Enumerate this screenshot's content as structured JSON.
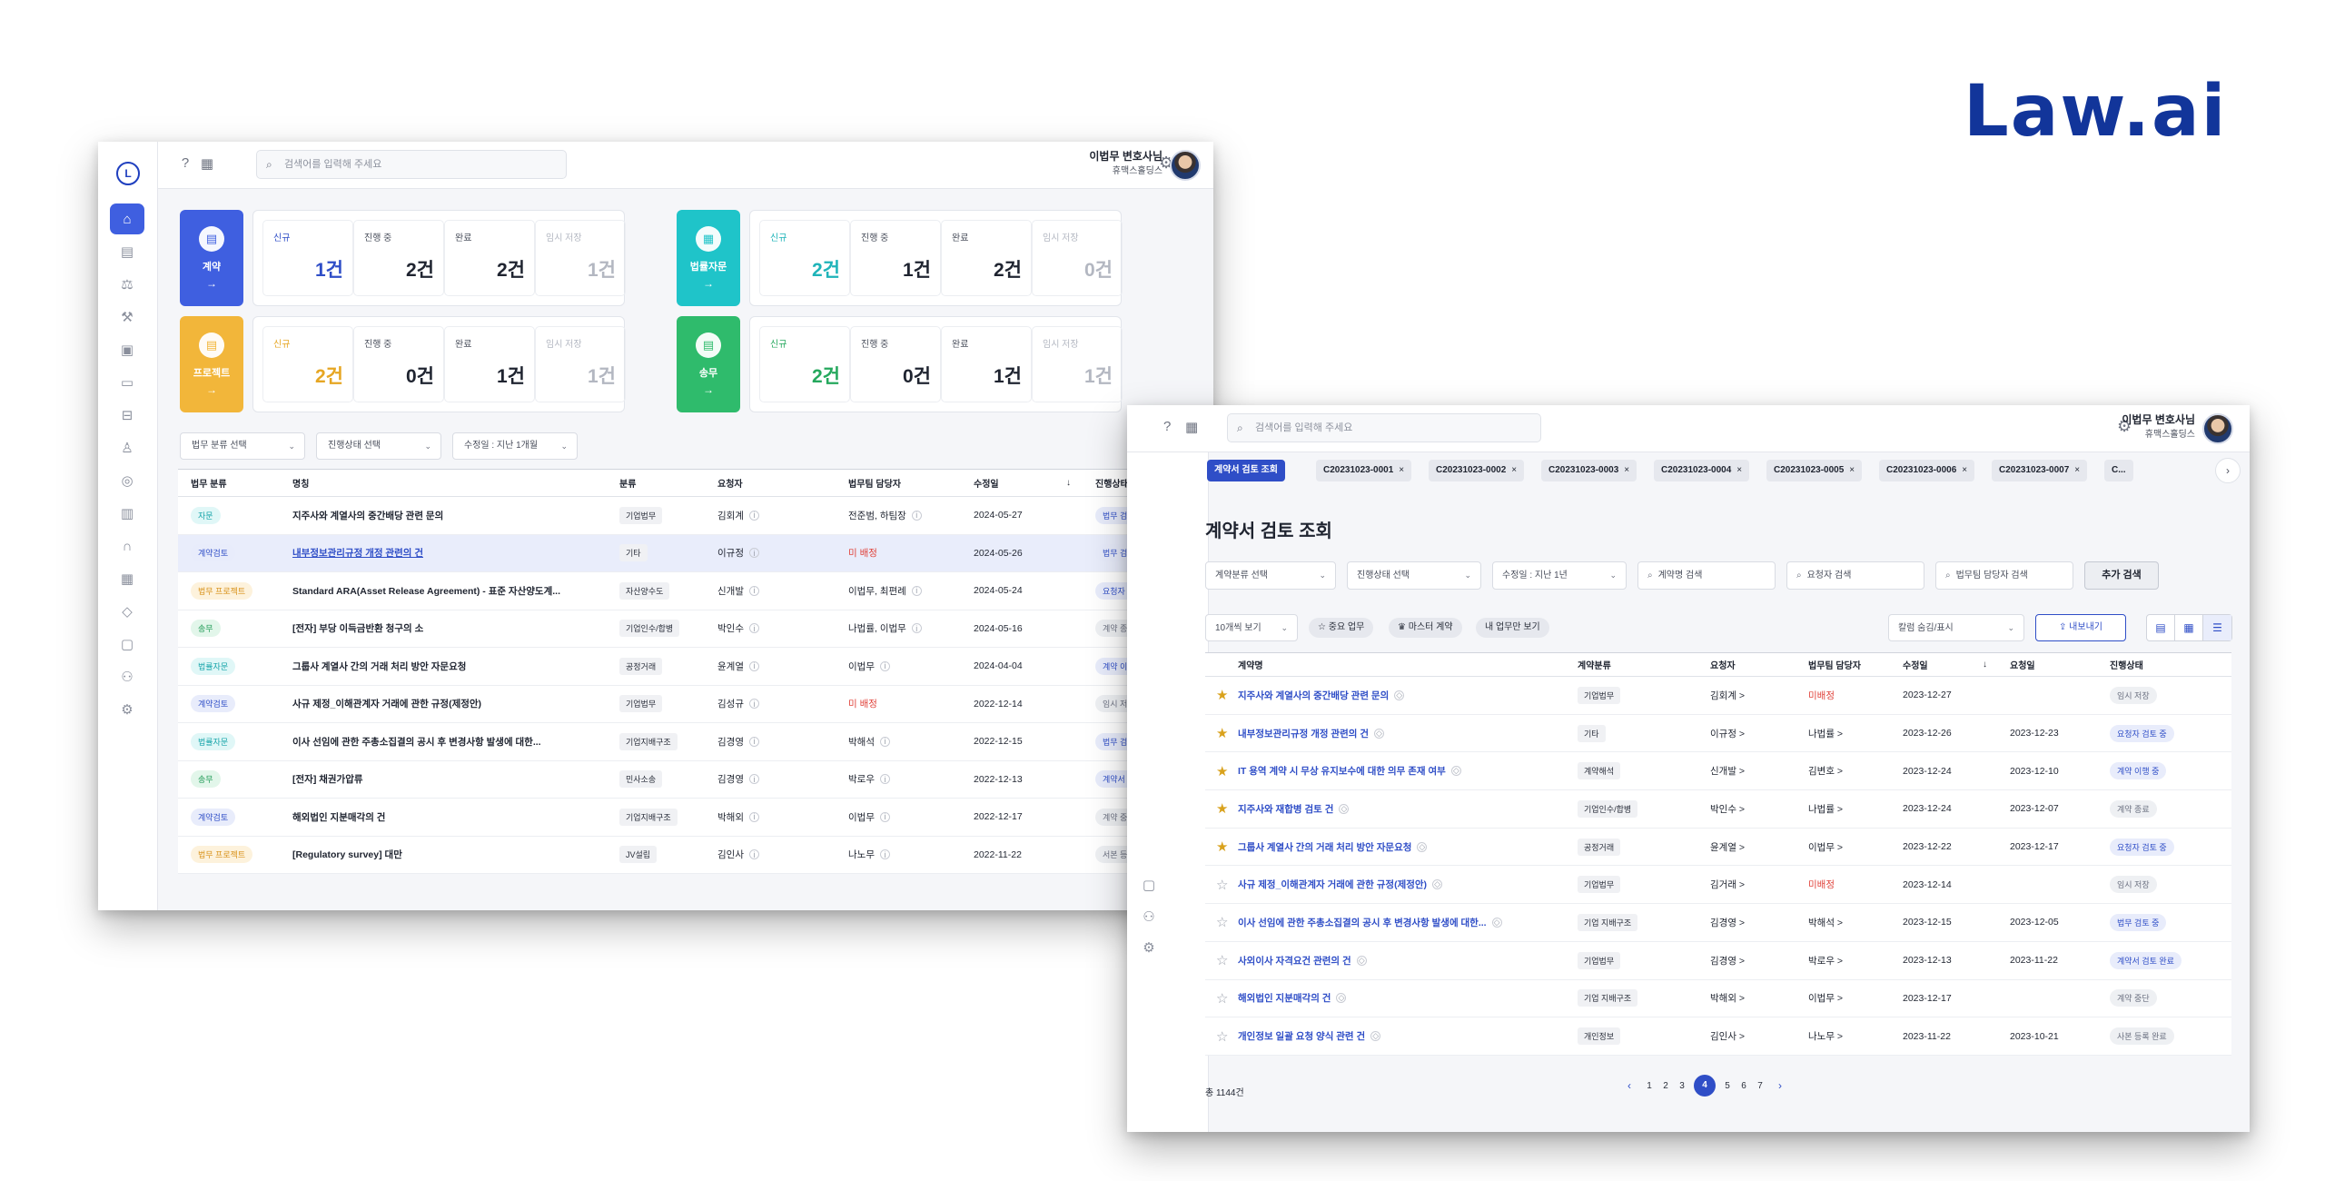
{
  "brand": "Law.ai",
  "colors": {
    "primary": "#2f4ec7",
    "contract": "#3f5fe0",
    "advice": "#1fc4c9",
    "project": "#f2b63a",
    "litigation": "#2fbb6c",
    "danger": "#e0433b",
    "star": "#d9a21d"
  },
  "win1": {
    "search_placeholder": "검색어를 입력해 주세요",
    "user_name": "이법무 변호사님",
    "user_org": "휴맥스홀딩스",
    "categories": [
      {
        "label": "계약",
        "icon": "document-icon",
        "arrow": "→"
      },
      {
        "label": "법률자문",
        "icon": "building-icon",
        "arrow": "→"
      },
      {
        "label": "프로젝트",
        "icon": "document-icon",
        "arrow": "→"
      },
      {
        "label": "송무",
        "icon": "document-icon",
        "arrow": "→"
      }
    ],
    "stat_labels": [
      "신규",
      "진행 중",
      "완료",
      "임시 저장"
    ],
    "stats": [
      [
        "1건",
        "2건",
        "2건",
        "1건"
      ],
      [
        "2건",
        "1건",
        "2건",
        "0건"
      ],
      [
        "2건",
        "0건",
        "1건",
        "1건"
      ],
      [
        "2건",
        "0건",
        "1건",
        "1건"
      ]
    ],
    "filters": [
      "법무 분류 선택",
      "진행상태 선택",
      "수정일 : 지난 1개월"
    ],
    "headers": [
      "법무 분류",
      "명칭",
      "분류",
      "요청자",
      "법무팀 담당자",
      "수정일",
      "진행상태"
    ],
    "sort_icon": "↓",
    "rows": [
      {
        "type": "자문",
        "name": "지주사와 계열사의 중간배당 관련 문의",
        "cat": "기업법무",
        "req": "김회계",
        "owner": "전준범, 하팀장",
        "date": "2024-05-27",
        "status": "법무 검토 중"
      },
      {
        "type": "계약검토",
        "name": "내부정보관리규정 개정 관련의 건",
        "cat": "기타",
        "req": "이규정",
        "owner": "미 배정",
        "date": "2024-05-26",
        "status": "법무 검토 중"
      },
      {
        "type": "법무 프로젝트",
        "name": "Standard ARA(Asset Release Agreement) - 표준 자산양도계...",
        "cat": "자산양수도",
        "req": "신개발",
        "owner": "이법무, 최편례",
        "date": "2024-05-24",
        "status": "요청자 회신 중"
      },
      {
        "type": "송무",
        "name": "[전자] 부당 이득금반환 청구의 소",
        "cat": "기업인수/합병",
        "req": "박인수",
        "owner": "나법률, 이법무",
        "date": "2024-05-16",
        "status": "계약 종료"
      },
      {
        "type": "법률자문",
        "name": "그룹사 계열사 간의 거래 처리 방안 자문요청",
        "cat": "공정거래",
        "req": "윤계열",
        "owner": "이법무",
        "date": "2024-04-04",
        "status": "계약 이행 중"
      },
      {
        "type": "계약검토",
        "name": "사규 제정_이해관계자 거래에 관한 규정(제정안)",
        "cat": "기업법무",
        "req": "김성규",
        "owner": "미 배정",
        "date": "2022-12-14",
        "status": "임시 저장"
      },
      {
        "type": "법률자문",
        "name": "이사 선임에 관한 주총소집결의 공시 후 변경사항 발생에 대한...",
        "cat": "기업지배구조",
        "req": "김경영",
        "owner": "박해석",
        "date": "2022-12-15",
        "status": "법무 검토 중"
      },
      {
        "type": "송무",
        "name": "[전자] 채권가압류",
        "cat": "민사소송",
        "req": "김경영",
        "owner": "박로우",
        "date": "2022-12-13",
        "status": "계약서 검토 완료"
      },
      {
        "type": "계약검토",
        "name": "해외법인 지분매각의 건",
        "cat": "기업지배구조",
        "req": "박해외",
        "owner": "이법무",
        "date": "2022-12-17",
        "status": "계약 중단"
      },
      {
        "type": "법무 프로젝트",
        "name": "[Regulatory survey] 대만",
        "cat": "JV설립",
        "req": "김인사",
        "owner": "나노무",
        "date": "2022-11-22",
        "status": "서본 등록 완료"
      }
    ]
  },
  "win2": {
    "search_placeholder": "검색어를 입력해 주세요",
    "user_name": "이법무 변호사님",
    "user_org": "휴맥스홀딩스",
    "tabs": [
      "계약서 검토 조회",
      "C20231023-0001",
      "C20231023-0002",
      "C20231023-0003",
      "C20231023-0004",
      "C20231023-0005",
      "C20231023-0006",
      "C20231023-0007",
      "C..."
    ],
    "tab_close": "×",
    "title": "계약서 검토 조회",
    "filters": [
      "계약분류 선택",
      "진행상태 선택",
      "수정일 : 지난 1년",
      "계약명 검색",
      "요청자 검색",
      "법무팀 담당자 검색"
    ],
    "search_button": "추가 검색",
    "page_size": "10개씩 보기",
    "quick_filters": [
      "☆ 중요 업무",
      "♛ 마스터 계약",
      "내 업무만 보기"
    ],
    "column_toggle": "칼럼 숨김/표시",
    "export": "내보내기",
    "headers": [
      "계약명",
      "계약분류",
      "요청자",
      "법무팀 담당자",
      "수정일",
      "요청일",
      "진행상태"
    ],
    "rows": [
      {
        "starred": true,
        "name": "지주사와 계열사의 중간배당 관련 문의",
        "cat": "기업법무",
        "req": "김회계 >",
        "owner": "미배정",
        "mod": "2023-12-27",
        "reqd": "",
        "status": "임시 저장"
      },
      {
        "starred": true,
        "name": "내부정보관리규정 개정 관련의 건",
        "cat": "기타",
        "req": "이규정 >",
        "owner": "나법률 >",
        "mod": "2023-12-26",
        "reqd": "2023-12-23",
        "status": "요청자 검토 중"
      },
      {
        "starred": true,
        "name": "IT 용역 계약 시 무상 유지보수에 대한 의무 존재 여부",
        "cat": "계약해석",
        "req": "신개발 >",
        "owner": "김변호 >",
        "mod": "2023-12-24",
        "reqd": "2023-12-10",
        "status": "계약 이행 중"
      },
      {
        "starred": true,
        "name": "지주사와 재합병 검토 건",
        "cat": "기업인수/합병",
        "req": "박인수 >",
        "owner": "나법률 >",
        "mod": "2023-12-24",
        "reqd": "2023-12-07",
        "status": "계약 종료"
      },
      {
        "starred": true,
        "name": "그룹사 계열사 간의 거래 처리 방안 자문요청",
        "cat": "공정거래",
        "req": "윤계열 >",
        "owner": "이법무 >",
        "mod": "2023-12-22",
        "reqd": "2023-12-17",
        "status": "요청자 검토 중"
      },
      {
        "starred": false,
        "name": "사규 제정_이해관계자 거래에 관한 규정(제정안)",
        "cat": "기업법무",
        "req": "김거래 >",
        "owner": "미배정",
        "mod": "2023-12-14",
        "reqd": "",
        "status": "임시 저장"
      },
      {
        "starred": false,
        "name": "이사 선임에 관한 주총소집결의 공시 후 변경사항 발생에 대한...",
        "cat": "기업 지배구조",
        "req": "김경영 >",
        "owner": "박해석 >",
        "mod": "2023-12-15",
        "reqd": "2023-12-05",
        "status": "법무 검토 중"
      },
      {
        "starred": false,
        "name": "사외이사 자격요건 관련의 건",
        "cat": "기업법무",
        "req": "김경영 >",
        "owner": "박로우 >",
        "mod": "2023-12-13",
        "reqd": "2023-11-22",
        "status": "계약서 검토 완료"
      },
      {
        "starred": false,
        "name": "해외법인 지분매각의 건",
        "cat": "기업 지배구조",
        "req": "박해외 >",
        "owner": "이법무 >",
        "mod": "2023-12-17",
        "reqd": "",
        "status": "계약 중단"
      },
      {
        "starred": false,
        "name": "개인정보 일괄 요청 양식 관련 건",
        "cat": "개인정보",
        "req": "김인사 >",
        "owner": "나노무 >",
        "mod": "2023-11-22",
        "reqd": "2023-10-21",
        "status": "사본 등록 완료"
      }
    ],
    "total": "총 1144건",
    "pages": [
      "1",
      "2",
      "3",
      "4",
      "5",
      "6",
      "7"
    ],
    "current_page": "4",
    "prev": "‹",
    "next": "›"
  }
}
